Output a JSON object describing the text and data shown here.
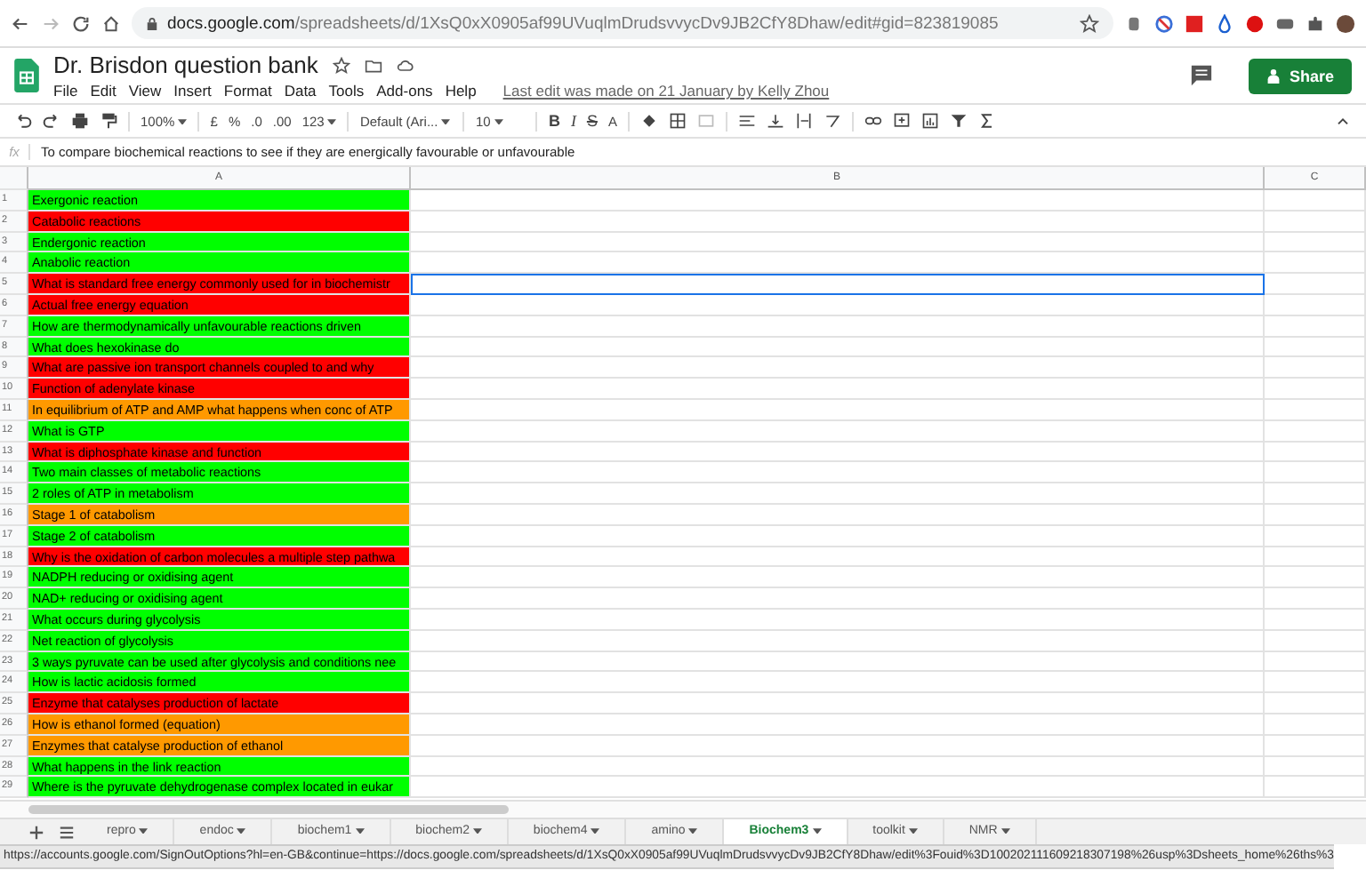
{
  "browser": {
    "url_host": "docs.google.com",
    "url_path": "/spreadsheets/d/1XsQ0xX0905af99UVuqlmDrudsvvycDv9JB2CfY8Dhaw/edit#gid=823819085"
  },
  "document": {
    "title": "Dr. Brisdon question bank",
    "menu": [
      "File",
      "Edit",
      "View",
      "Insert",
      "Format",
      "Data",
      "Tools",
      "Add-ons",
      "Help"
    ],
    "last_edit": "Last edit was made on 21 January by Kelly Zhou",
    "share": "Share"
  },
  "toolbar": {
    "zoom": "100%",
    "currency": "£",
    "percent": "%",
    "decimal_less": ".0",
    "decimal_more": ".00",
    "format": "123",
    "font": "Default (Ari...",
    "font_size": "10",
    "bold": "B",
    "italic": "I",
    "strike": "S",
    "text_color": "A"
  },
  "formula_bar": {
    "fx": "fx",
    "value": "To compare biochemical reactions to see if they are energically favourable or unfavourable"
  },
  "columns": [
    "A",
    "B",
    "C"
  ],
  "rows": [
    {
      "num": "1",
      "text": "Exergonic reaction",
      "color": "#00ff00",
      "selected": false
    },
    {
      "num": "2",
      "text": "Catabolic reactions",
      "color": "#ff0000",
      "selected": false
    },
    {
      "num": "3",
      "text": "Endergonic reaction",
      "color": "#00ff00",
      "selected": false
    },
    {
      "num": "4",
      "text": "Anabolic reaction",
      "color": "#00ff00",
      "selected": false
    },
    {
      "num": "5",
      "text": "What is standard free energy commonly used for in biochemistr",
      "color": "#ff0000",
      "selected": true
    },
    {
      "num": "6",
      "text": "Actual free energy equation",
      "color": "#ff0000",
      "selected": false
    },
    {
      "num": "7",
      "text": "How are thermodynamically unfavourable reactions driven",
      "color": "#00ff00",
      "selected": false
    },
    {
      "num": "8",
      "text": "What does hexokinase do",
      "color": "#00ff00",
      "selected": false
    },
    {
      "num": "9",
      "text": "What are passive ion transport channels coupled to and why",
      "color": "#ff0000",
      "selected": false
    },
    {
      "num": "10",
      "text": "Function of adenylate kinase",
      "color": "#ff0000",
      "selected": false
    },
    {
      "num": "11",
      "text": "In equilibrium of ATP and AMP what happens when conc of ATP",
      "color": "#ff9900",
      "selected": false
    },
    {
      "num": "12",
      "text": "What is GTP",
      "color": "#00ff00",
      "selected": false
    },
    {
      "num": "13",
      "text": "What is diphosphate kinase and function",
      "color": "#ff0000",
      "selected": false
    },
    {
      "num": "14",
      "text": "Two main classes of metabolic reactions",
      "color": "#00ff00",
      "selected": false
    },
    {
      "num": "15",
      "text": "2 roles of ATP in metabolism",
      "color": "#00ff00",
      "selected": false
    },
    {
      "num": "16",
      "text": "Stage 1 of catabolism",
      "color": "#ff9900",
      "selected": false
    },
    {
      "num": "17",
      "text": "Stage 2 of catabolism",
      "color": "#00ff00",
      "selected": false
    },
    {
      "num": "18",
      "text": "Why is the oxidation of carbon molecules a multiple step pathwa",
      "color": "#ff0000",
      "selected": false
    },
    {
      "num": "19",
      "text": "NADPH reducing or oxidising agent",
      "color": "#00ff00",
      "selected": false
    },
    {
      "num": "20",
      "text": "NAD+ reducing or oxidising agent",
      "color": "#00ff00",
      "selected": false
    },
    {
      "num": "21",
      "text": "What occurs during glycolysis",
      "color": "#00ff00",
      "selected": false
    },
    {
      "num": "22",
      "text": "Net reaction of glycolysis",
      "color": "#00ff00",
      "selected": false
    },
    {
      "num": "23",
      "text": "3 ways pyruvate can be used after glycolysis and conditions nee",
      "color": "#00ff00",
      "selected": false
    },
    {
      "num": "24",
      "text": "How is lactic acidosis formed",
      "color": "#00ff00",
      "selected": false
    },
    {
      "num": "25",
      "text": "Enzyme that catalyses production of lactate",
      "color": "#ff0000",
      "selected": false
    },
    {
      "num": "26",
      "text": "How is ethanol formed (equation)",
      "color": "#ff9900",
      "selected": false
    },
    {
      "num": "27",
      "text": "Enzymes that catalyse production of ethanol",
      "color": "#ff9900",
      "selected": false
    },
    {
      "num": "28",
      "text": "What happens in the link reaction",
      "color": "#00ff00",
      "selected": false
    },
    {
      "num": "29",
      "text": "Where is the pyruvate dehydrogenase complex located in eukar",
      "color": "#00ff00",
      "selected": false
    }
  ],
  "sheet_tabs": [
    {
      "label": "repro",
      "selected": false
    },
    {
      "label": "endoc",
      "selected": false
    },
    {
      "label": "biochem1",
      "selected": false
    },
    {
      "label": "biochem2",
      "selected": false
    },
    {
      "label": "biochem4",
      "selected": false
    },
    {
      "label": "amino",
      "selected": false
    },
    {
      "label": "Biochem3",
      "selected": true
    },
    {
      "label": "toolkit",
      "selected": false
    },
    {
      "label": "NMR",
      "selected": false
    }
  ],
  "status_url": "https://accounts.google.com/SignOutOptions?hl=en-GB&continue=https://docs.google.com/spreadsheets/d/1XsQ0xX0905af99UVuqlmDrudsvvycDv9JB2CfY8Dhaw/edit%3Fouid%3D100202111609218307198%26usp%3Dsheets_home%26ths%3"
}
